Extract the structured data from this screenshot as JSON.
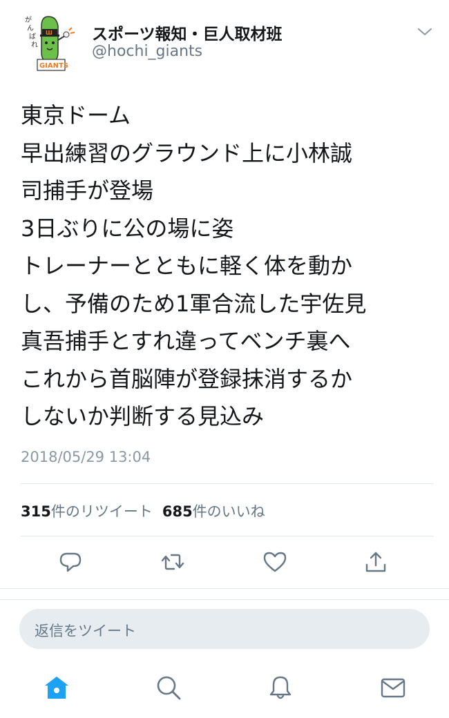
{
  "tweet": {
    "display_name": "スポーツ報知・巨人取材班",
    "handle": "@hochi_giants",
    "lines": [
      "東京ドーム",
      "早出練習のグラウンド上に小林誠",
      "司捕手が登場",
      "3日ぶりに公の場に姿",
      "トレーナーとともに軽く体を動か",
      "し、予備のため1軍合流した宇佐見",
      "真吾捕手とすれ違ってベンチ裏へ",
      "これから首脳陣が登録抹消するか",
      "しないか判断する見込み"
    ],
    "timestamp": "2018/05/29 13:04"
  },
  "stats": {
    "retweets_count": "315",
    "retweets_label": "件のリツイート",
    "likes_count": "685",
    "likes_label": "件のいいね"
  },
  "avatar": {
    "text_vertical": "がんばれ",
    "badge": "GIANTS"
  },
  "reply": {
    "placeholder": "返信をツイート"
  },
  "colors": {
    "accent": "#1da1f2",
    "icon_gray": "#657786",
    "text_primary": "#14171a",
    "text_secondary": "#657786"
  },
  "icons": {
    "actions": [
      "reply-icon",
      "retweet-icon",
      "like-icon",
      "share-icon"
    ],
    "tabs": [
      "home-icon",
      "search-icon",
      "notifications-icon",
      "messages-icon"
    ]
  }
}
